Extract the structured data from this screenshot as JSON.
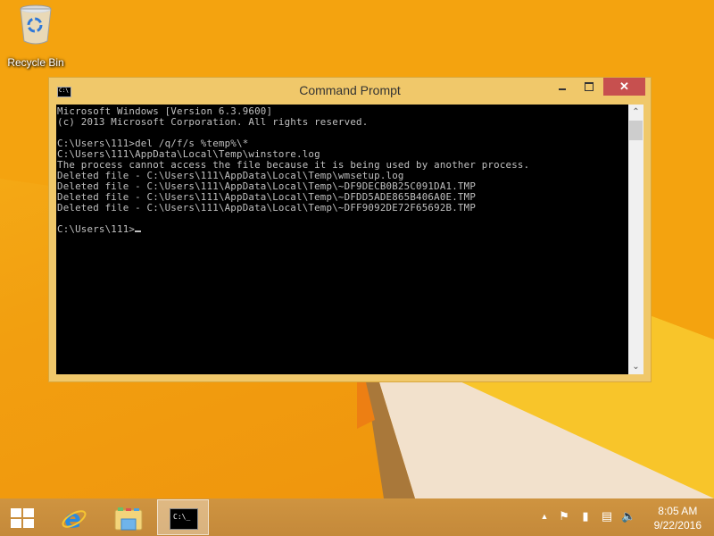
{
  "desktop": {
    "icons": [
      {
        "label": "Recycle Bin",
        "icon": "recycle-bin-icon"
      }
    ],
    "wallpaper_colors": {
      "primary": "#f4a40e",
      "cream": "#f3e3cf",
      "yellow": "#f8c62a"
    }
  },
  "window": {
    "title": "Command Prompt",
    "icon": "cmd-icon",
    "controls": {
      "minimize": "minimize",
      "maximize": "maximize",
      "close": "✕"
    },
    "accent": "#f0c86a",
    "close_color": "#c7504f"
  },
  "console": {
    "lines": [
      "Microsoft Windows [Version 6.3.9600]",
      "(c) 2013 Microsoft Corporation. All rights reserved.",
      "",
      "C:\\Users\\111>del /q/f/s %temp%\\*",
      "C:\\Users\\111\\AppData\\Local\\Temp\\winstore.log",
      "The process cannot access the file because it is being used by another process.",
      "Deleted file - C:\\Users\\111\\AppData\\Local\\Temp\\wmsetup.log",
      "Deleted file - C:\\Users\\111\\AppData\\Local\\Temp\\~DF9DECB0B25C091DA1.TMP",
      "Deleted file - C:\\Users\\111\\AppData\\Local\\Temp\\~DFDD5ADE865B406A0E.TMP",
      "Deleted file - C:\\Users\\111\\AppData\\Local\\Temp\\~DFF9092DE72F65692B.TMP",
      ""
    ],
    "prompt": "C:\\Users\\111>"
  },
  "taskbar": {
    "items": [
      {
        "name": "start",
        "icon": "windows-logo-icon"
      },
      {
        "name": "internet-explorer",
        "icon": "internet-explorer-icon"
      },
      {
        "name": "file-explorer",
        "icon": "folder-icon"
      },
      {
        "name": "command-prompt",
        "icon": "cmd-icon",
        "active": true
      }
    ],
    "tray": {
      "icons": [
        "show-hidden-icons-chevron",
        "action-center-flag-icon",
        "battery-icon",
        "network-icon",
        "volume-icon"
      ],
      "time": "8:05 AM",
      "date": "9/22/2016"
    }
  }
}
